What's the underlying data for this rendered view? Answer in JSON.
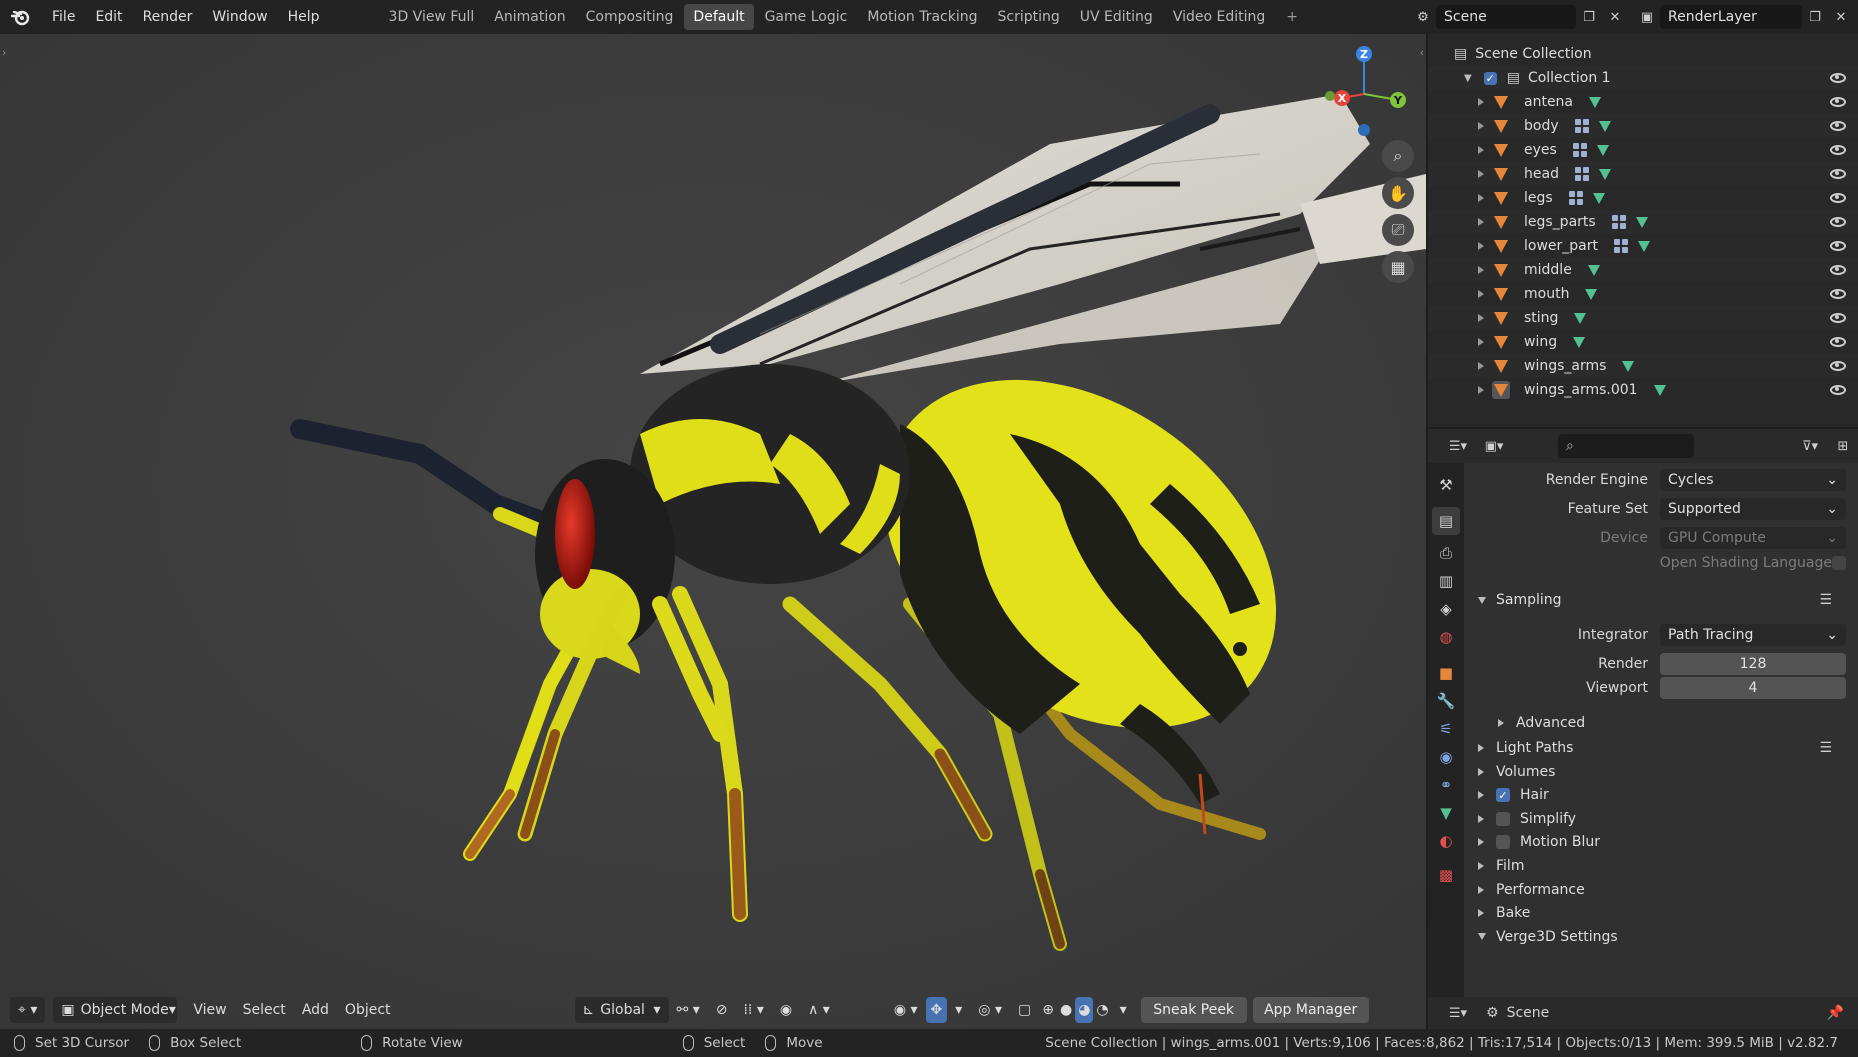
{
  "topbar": {
    "menus": [
      "File",
      "Edit",
      "Render",
      "Window",
      "Help"
    ],
    "workspaces": [
      "3D View Full",
      "Animation",
      "Compositing",
      "Default",
      "Game Logic",
      "Motion Tracking",
      "Scripting",
      "UV Editing",
      "Video Editing"
    ],
    "active_workspace": "Default",
    "add_tab": "+",
    "scene_name": "Scene",
    "view_layer": "RenderLayer"
  },
  "viewport": {
    "gizmo": {
      "z": "Z",
      "y": "Y",
      "x": "X"
    },
    "header": {
      "mode": "Object Mode",
      "menus": [
        "View",
        "Select",
        "Add",
        "Object"
      ],
      "orientation": "Global",
      "sneak_peek": "Sneak Peek",
      "app_manager": "App Manager"
    }
  },
  "outliner": {
    "root": "Scene Collection",
    "collection": "Collection 1",
    "objects": [
      {
        "name": "antena",
        "modifier": false
      },
      {
        "name": "body",
        "modifier": true
      },
      {
        "name": "eyes",
        "modifier": true
      },
      {
        "name": "head",
        "modifier": true
      },
      {
        "name": "legs",
        "modifier": true
      },
      {
        "name": "legs_parts",
        "modifier": true
      },
      {
        "name": "lower_part",
        "modifier": true
      },
      {
        "name": "middle",
        "modifier": false
      },
      {
        "name": "mouth",
        "modifier": false
      },
      {
        "name": "sting",
        "modifier": false
      },
      {
        "name": "wing",
        "modifier": false
      },
      {
        "name": "wings_arms",
        "modifier": false
      },
      {
        "name": "wings_arms.001",
        "modifier": false
      }
    ]
  },
  "properties": {
    "search_placeholder": "",
    "render_engine_label": "Render Engine",
    "render_engine": "Cycles",
    "feature_set_label": "Feature Set",
    "feature_set": "Supported",
    "device_label": "Device",
    "device": "GPU Compute",
    "osl_label": "Open Shading Language",
    "sampling": "Sampling",
    "integrator_label": "Integrator",
    "integrator": "Path Tracing",
    "render_label": "Render",
    "render_samples": "128",
    "viewport_label": "Viewport",
    "viewport_samples": "4",
    "advanced": "Advanced",
    "panels": [
      "Light Paths",
      "Volumes",
      "Hair",
      "Simplify",
      "Motion Blur",
      "Film",
      "Performance",
      "Bake",
      "Verge3D Settings"
    ],
    "hair_checked": true,
    "simplify_checked": false,
    "motion_blur_checked": false,
    "footer_scene": "Scene"
  },
  "statusbar": {
    "set_cursor": "Set 3D Cursor",
    "box_select": "Box Select",
    "rotate_view": "Rotate View",
    "select": "Select",
    "move": "Move",
    "stats": "Scene Collection | wings_arms.001 | Verts:9,106 | Faces:8,862 | Tris:17,514 | Objects:0/13 | Mem: 399.5 MiB | v2.82.7"
  },
  "colors": {
    "accent": "#4772b3",
    "mesh_orange": "#e4873a",
    "mesh_data_green": "#55c191",
    "wasp_yellow": "#e3e21a",
    "wasp_black": "#1e1e1a"
  }
}
